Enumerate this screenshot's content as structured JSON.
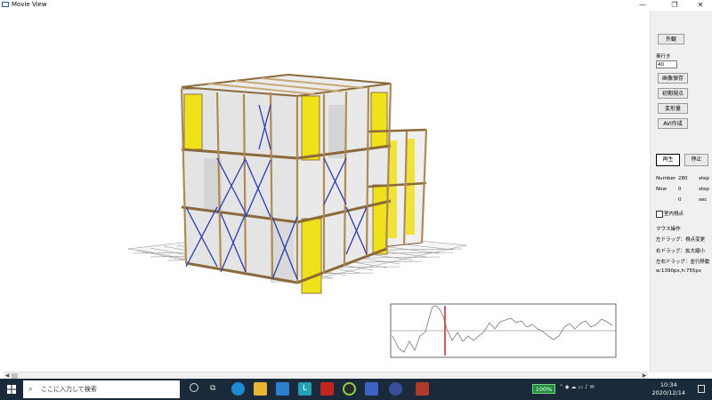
{
  "window": {
    "title": "Movie View",
    "minimize": "—",
    "restore": "❐",
    "close": "✕"
  },
  "sidebar": {
    "exterior_button": "外観",
    "depth_label": "奥行き",
    "depth_value": "40",
    "save_image_button": "画像保存",
    "initial_view_button": "初期視点",
    "deform_button": "変形量",
    "avi_button": "AVI作成",
    "play_button": "再生",
    "stop_button": "停止",
    "number_label": "Number",
    "number_value": "280",
    "number_unit": "step",
    "now_label": "Now",
    "now_value": "0",
    "now_unit": "step",
    "time_value": "0",
    "time_unit": "sec",
    "indoor_view_label": "室内視点",
    "mouse_ops_title": "マウス操作",
    "left_drag": "左ドラッグ：視点変更",
    "right_drag": "右ドラッグ：拡大縮小",
    "both_drag": "左右ドラッグ：並行移動",
    "size_text": "w:1390px,h:755px"
  },
  "taskbar": {
    "search_placeholder": "ここに入力して検索",
    "battery": "100%",
    "time": "10:34",
    "date": "2020/12/14"
  },
  "icons": {
    "start": "windows-start-icon",
    "search": "search-icon",
    "cortana": "cortana-icon",
    "taskview": "task-view-icon"
  },
  "colors": {
    "panel_yellow": "#f0e21a",
    "timber": "#c9a878",
    "brace_blue": "#2a3bb5",
    "wave_red": "#c0262c",
    "taskbar": "#1b2a3a"
  }
}
